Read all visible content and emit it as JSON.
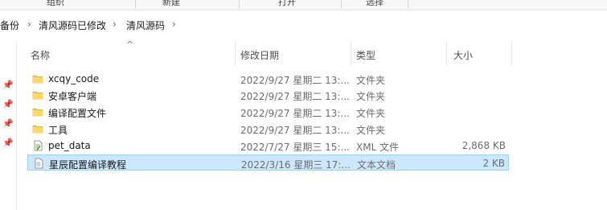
{
  "ribbon": {
    "groups": [
      "组织",
      "新建",
      "打开",
      "选择"
    ]
  },
  "breadcrumb": {
    "items": [
      "备份",
      "清风源码已修改",
      "清风源码"
    ]
  },
  "columns": {
    "name": "名称",
    "modified": "修改日期",
    "type": "类型",
    "size": "大小"
  },
  "files": [
    {
      "name": "xcqy_code",
      "modified": "2022/9/27 星期二 13:...",
      "type": "文件夹",
      "size": "",
      "icon": "folder-icon"
    },
    {
      "name": "安卓客户端",
      "modified": "2022/9/27 星期二 13:...",
      "type": "文件夹",
      "size": "",
      "icon": "folder-icon"
    },
    {
      "name": "编译配置文件",
      "modified": "2022/9/27 星期二 13:...",
      "type": "文件夹",
      "size": "",
      "icon": "folder-icon"
    },
    {
      "name": "工具",
      "modified": "2022/9/27 星期二 13:...",
      "type": "文件夹",
      "size": "",
      "icon": "folder-icon"
    },
    {
      "name": "pet_data",
      "modified": "2022/7/27 星期三 15:...",
      "type": "XML 文件",
      "size": "2,868 KB",
      "icon": "xml-file-icon"
    },
    {
      "name": "星辰配置编译教程",
      "modified": "2022/3/16 星期三 17:...",
      "type": "文本文档",
      "size": "2 KB",
      "icon": "text-file-icon"
    }
  ],
  "selected_index": 5,
  "colors": {
    "folder": "#f6c444",
    "selection_bg": "#cce8ff",
    "selection_border": "#99d1ff"
  }
}
